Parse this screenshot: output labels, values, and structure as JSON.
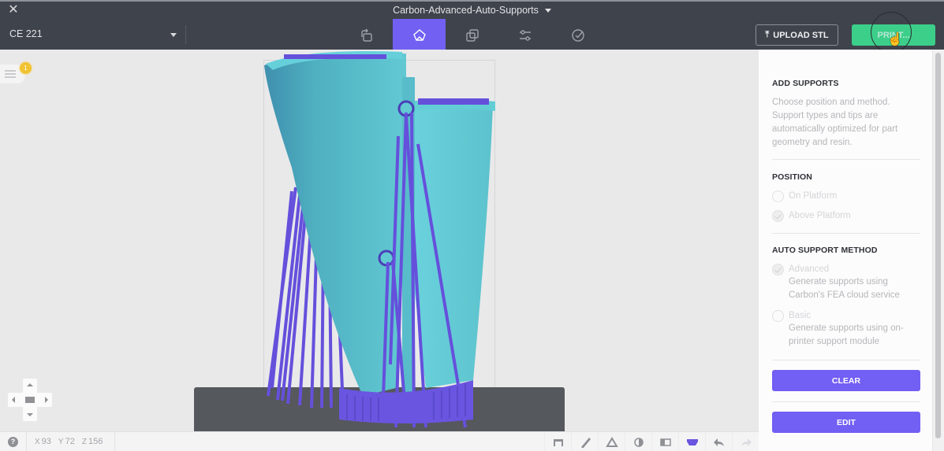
{
  "window": {
    "close_icon": "close-icon",
    "document_title": "Carbon-Advanced-Auto-Supports",
    "printer": "CE 221"
  },
  "toolbar": {
    "tabs": [
      {
        "id": "orient",
        "icon": "orient-icon",
        "active": false
      },
      {
        "id": "supports",
        "icon": "supports-icon",
        "active": true
      },
      {
        "id": "pack",
        "icon": "pack-icon",
        "active": false
      },
      {
        "id": "settings",
        "icon": "sliders-icon",
        "active": false
      },
      {
        "id": "review",
        "icon": "check-circle-icon",
        "active": false
      }
    ],
    "upload_label": "UPLOAD STL",
    "print_label": "PRINT..."
  },
  "viewport": {
    "notes_badge": "1",
    "colors": {
      "part": "#5fc6cf",
      "supports": "#6a55e0",
      "platform": "#55585c"
    }
  },
  "statusbar": {
    "help_icon": "?",
    "coords": {
      "x_label": "X",
      "x": "93",
      "y_label": "Y",
      "y": "72",
      "z_label": "Z",
      "z": "156"
    },
    "tools": [
      {
        "id": "platform",
        "icon": "platform-icon",
        "active": false
      },
      {
        "id": "measure",
        "icon": "ruler-icon",
        "active": false
      },
      {
        "id": "overhang",
        "icon": "triangle-icon",
        "active": false
      },
      {
        "id": "contrast",
        "icon": "contrast-icon",
        "active": false
      },
      {
        "id": "section",
        "icon": "section-view-icon",
        "active": false
      },
      {
        "id": "supports-view",
        "icon": "supports-view-icon",
        "active": true
      },
      {
        "id": "undo",
        "icon": "undo-icon",
        "active": false
      },
      {
        "id": "redo",
        "icon": "redo-icon",
        "active": false
      }
    ]
  },
  "panel": {
    "add_supports_title": "ADD SUPPORTS",
    "add_supports_desc": "Choose position and method. Support types and tips are automatically optimized for part geometry and resin.",
    "position_title": "POSITION",
    "position_options": [
      {
        "label": "On Platform",
        "checked": false
      },
      {
        "label": "Above Platform",
        "checked": true
      }
    ],
    "method_title": "AUTO SUPPORT METHOD",
    "method_options": [
      {
        "label": "Advanced",
        "desc": "Generate supports using Carbon's FEA cloud service",
        "checked": true
      },
      {
        "label": "Basic",
        "desc": "Generate supports using on-printer support module",
        "checked": false
      }
    ],
    "clear_label": "CLEAR",
    "edit_label": "EDIT"
  },
  "accent_color": "#7160f2",
  "print_color": "#3ccf8a"
}
